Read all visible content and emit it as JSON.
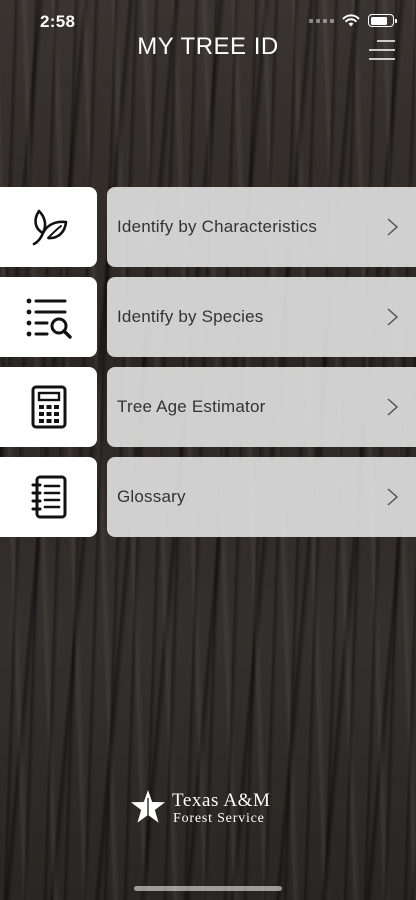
{
  "status_bar": {
    "time": "2:58",
    "battery_level": 0.8
  },
  "header": {
    "title": "MY TREE ID",
    "menu_icon": "hamburger-menu-icon"
  },
  "menu": {
    "items": [
      {
        "label": "Identify by Characteristics",
        "icon": "leaf-icon"
      },
      {
        "label": "Identify by Species",
        "icon": "list-search-icon"
      },
      {
        "label": "Tree Age Estimator",
        "icon": "calculator-icon"
      },
      {
        "label": "Glossary",
        "icon": "notebook-icon"
      }
    ],
    "chevron_icon": "chevron-right-icon"
  },
  "footer": {
    "logo_line1": "Texas A&M",
    "logo_line2": "Forest Service"
  },
  "colors": {
    "tile_bg": "#ffffff",
    "label_bg": "#dedede",
    "text": "#333333",
    "header_text": "#ffffff"
  }
}
